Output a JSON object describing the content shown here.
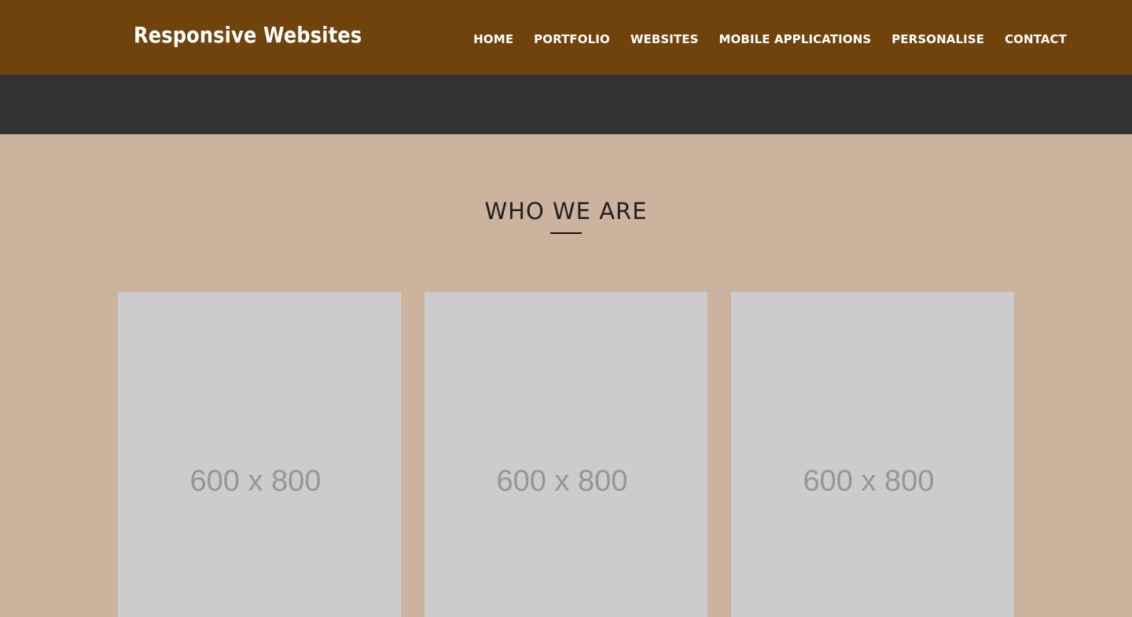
{
  "header": {
    "brand": "Responsive Websites",
    "background_color": "#70420c",
    "nav": [
      {
        "label": "HOME"
      },
      {
        "label": "PORTFOLIO"
      },
      {
        "label": "WEBSITES"
      },
      {
        "label": "MOBILE APPLICATIONS"
      },
      {
        "label": "PERSONALISE"
      },
      {
        "label": "CONTACT"
      }
    ]
  },
  "band": {
    "background_color": "#333333"
  },
  "about": {
    "title": "WHO WE ARE",
    "background_color": "#cbb39d",
    "cards": [
      {
        "placeholder": "600 x 800"
      },
      {
        "placeholder": "600 x 800"
      },
      {
        "placeholder": "600 x 800"
      }
    ]
  }
}
